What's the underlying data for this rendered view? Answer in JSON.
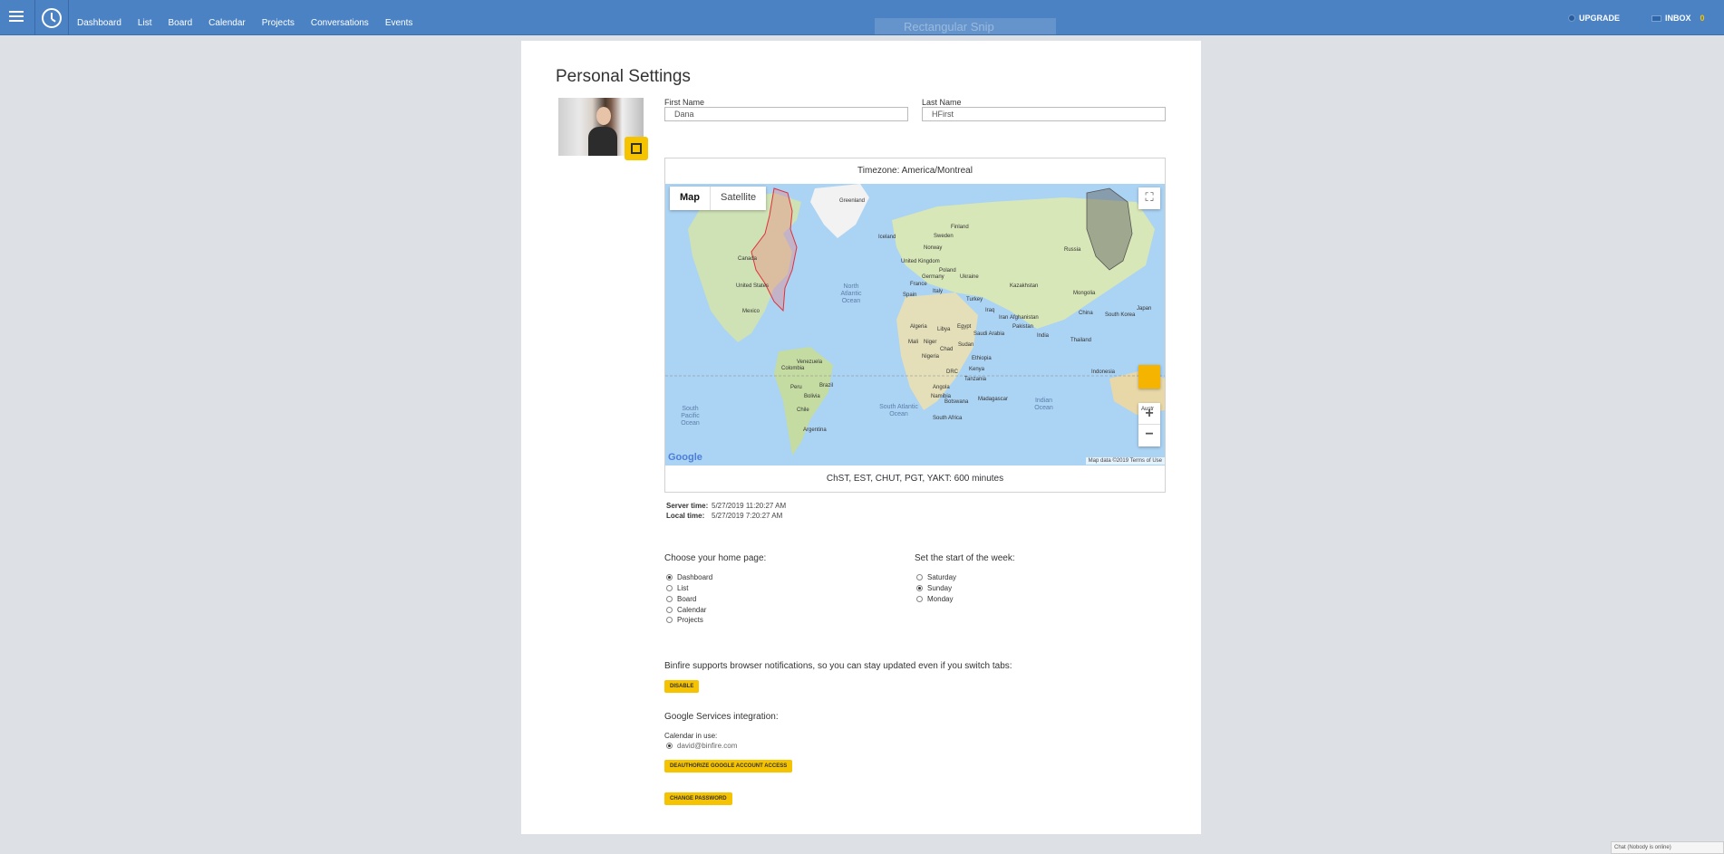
{
  "topbar": {
    "nav": [
      "Dashboard",
      "List",
      "Board",
      "Calendar",
      "Projects",
      "Conversations",
      "Events"
    ],
    "upgrade_label": "UPGRADE",
    "inbox_label": "INBOX",
    "inbox_count": "0",
    "ghost_text": "Rectangular Snip"
  },
  "page": {
    "title": "Personal Settings",
    "first_name_label": "First Name",
    "first_name_value": "Dana",
    "last_name_label": "Last Name",
    "last_name_value": "HFirst"
  },
  "map": {
    "timezone_header": "Timezone: America/Montreal",
    "footer_text": "ChST, EST, CHUT, PGT, YAKT: 600 minutes",
    "type_map": "Map",
    "type_satellite": "Satellite",
    "google_logo": "Google",
    "attribution": "Map data ©2019   Terms of Use",
    "labels": [
      "Greenland",
      "Iceland",
      "Finland",
      "Sweden",
      "Norway",
      "United Kingdom",
      "Poland",
      "Germany",
      "Ukraine",
      "France",
      "Spain",
      "Italy",
      "Turkey",
      "Iraq",
      "Iran",
      "Kazakhstan",
      "Russia",
      "Mongolia",
      "China",
      "South Korea",
      "Japan",
      "Afghanistan",
      "Pakistan",
      "India",
      "Thailand",
      "Indonesia",
      "Saudi Arabia",
      "Algeria",
      "Libya",
      "Egypt",
      "Mali",
      "Niger",
      "Chad",
      "Sudan",
      "Nigeria",
      "Ethiopia",
      "DRC",
      "Kenya",
      "Tanzania",
      "Angola",
      "Namibia",
      "Botswana",
      "Madagascar",
      "South Africa",
      "Canada",
      "United States",
      "Mexico",
      "Venezuela",
      "Colombia",
      "Peru",
      "Brazil",
      "Bolivia",
      "Chile",
      "Argentina",
      "Austr"
    ],
    "oceans": [
      "North Atlantic Ocean",
      "South Atlantic Ocean",
      "South Pacific Ocean",
      "Indian Ocean"
    ]
  },
  "times": {
    "server_label": "Server time:",
    "server_value": "5/27/2019 11:20:27 AM",
    "local_label": "Local time:",
    "local_value": "5/27/2019 7:20:27 AM"
  },
  "home_page": {
    "heading": "Choose your home page:",
    "options": [
      "Dashboard",
      "List",
      "Board",
      "Calendar",
      "Projects"
    ],
    "selected": "Dashboard"
  },
  "week_start": {
    "heading": "Set the start of the week:",
    "options": [
      "Saturday",
      "Sunday",
      "Monday"
    ],
    "selected": "Sunday"
  },
  "notifications": {
    "text": "Binfire supports browser notifications, so you can stay updated even if you switch tabs:",
    "disable_label": "DISABLE"
  },
  "google": {
    "heading": "Google Services integration:",
    "calendar_label": "Calendar in use:",
    "calendar_account": "david@binfire.com",
    "deauth_label": "DEAUTHORIZE GOOGLE ACCOUNT ACCESS"
  },
  "change_password_label": "CHANGE PASSWORD",
  "chat_status": "Chat (Nobody is online)",
  "colors": {
    "topbar": "#4a82c4",
    "accent": "#f5c300",
    "background": "#dde1e5"
  },
  "icons": [
    "hamburger-icon",
    "clock-icon",
    "upgrade-icon",
    "inbox-icon",
    "edit-icon",
    "fullscreen-icon",
    "pegman-icon",
    "zoom-in-icon",
    "zoom-out-icon"
  ]
}
